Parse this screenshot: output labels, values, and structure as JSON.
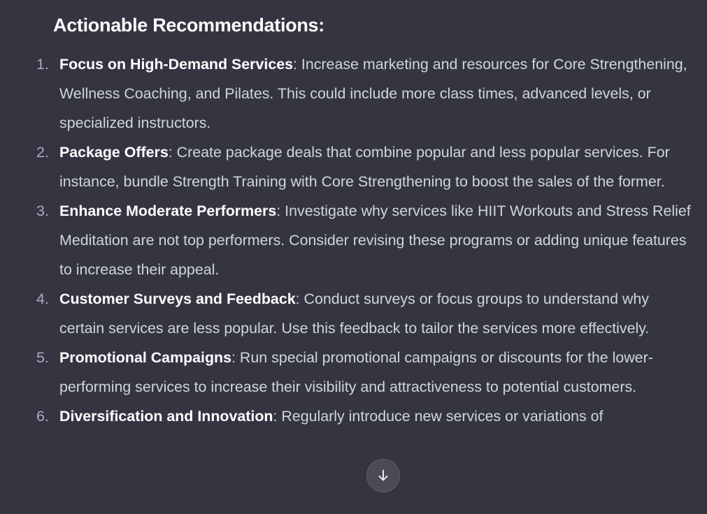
{
  "heading": "Actionable Recommendations:",
  "items": [
    {
      "number": "1.",
      "title": "Focus on High-Demand Services",
      "text": ": Increase marketing and resources for Core Strengthening, Wellness Coaching, and Pilates. This could include more class times, advanced levels, or specialized instructors."
    },
    {
      "number": "2.",
      "title": "Package Offers",
      "text": ": Create package deals that combine popular and less popular services. For instance, bundle Strength Training with Core Strengthening to boost the sales of the former."
    },
    {
      "number": "3.",
      "title": "Enhance Moderate Performers",
      "text": ": Investigate why services like HIIT Workouts and Stress Relief Meditation are not top performers. Consider revising these programs or adding unique features to increase their appeal."
    },
    {
      "number": "4.",
      "title": "Customer Surveys and Feedback",
      "text": ": Conduct surveys or focus groups to understand why certain services are less popular. Use this feedback to tailor the services more effectively."
    },
    {
      "number": "5.",
      "title": "Promotional Campaigns",
      "text": ": Run special promotional campaigns or discounts for the lower-performing services to increase their visibility and attractiveness to potential customers."
    },
    {
      "number": "6.",
      "title": "Diversification and Innovation",
      "text": ": Regularly introduce new services or variations of"
    }
  ],
  "scroll_button": {
    "icon": "arrow-down-icon"
  }
}
